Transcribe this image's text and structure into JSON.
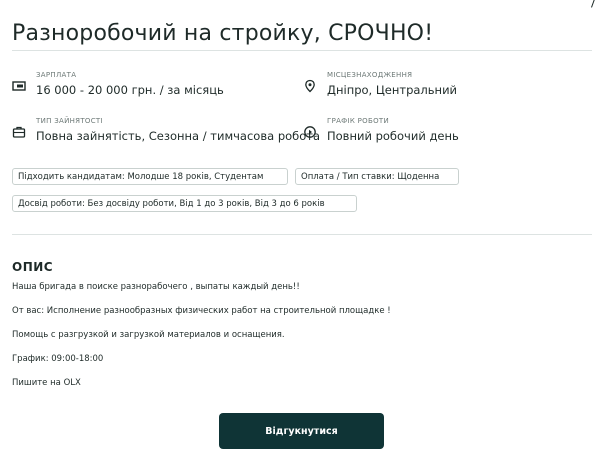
{
  "job": {
    "title": "Разноробочий на стройку, СРОЧНО!"
  },
  "params": {
    "salary": {
      "label": "ЗАРПЛАТА",
      "value": "16 000 - 20 000 грн. / за місяць",
      "icon": "banknote-icon"
    },
    "location": {
      "label": "МІСЦЕЗНАХОДЖЕННЯ",
      "value": "Дніпро, Центральний",
      "icon": "location-pin-icon"
    },
    "employment_type": {
      "label": "ТИП ЗАЙНЯТОСТІ",
      "value": "Повна зайнятість, Сезонна / тимчасова робота",
      "icon": "briefcase-icon"
    },
    "schedule": {
      "label": "ГРАФІК РОБОТИ",
      "value": "Повний робочий день",
      "icon": "clock-icon"
    }
  },
  "tags": [
    "Підходить кандидатам: Молодше 18 років, Студентам",
    "Оплата / Тип ставки: Щоденна",
    "Досвід роботи: Без досвіду роботи, Від 1 до 3 років, Від 3 до 6 років"
  ],
  "description": {
    "heading": "ОПИС",
    "lines": [
      "Наша бригада в поиске разнорабочего , выпаты каждый день!!",
      "От вас: Исполнение разнообразных физических работ на строительной площадке !",
      "Помощь с разгрузкой и загрузкой материалов и оснащения.",
      "График: 09:00-18:00",
      "Пишите на OLX"
    ]
  },
  "actions": {
    "apply_label": "Відгукнутися"
  },
  "colors": {
    "primary_button": "#0f3436",
    "text": "#1e2a28",
    "muted": "#6c7876",
    "border": "#c9d1cf"
  }
}
